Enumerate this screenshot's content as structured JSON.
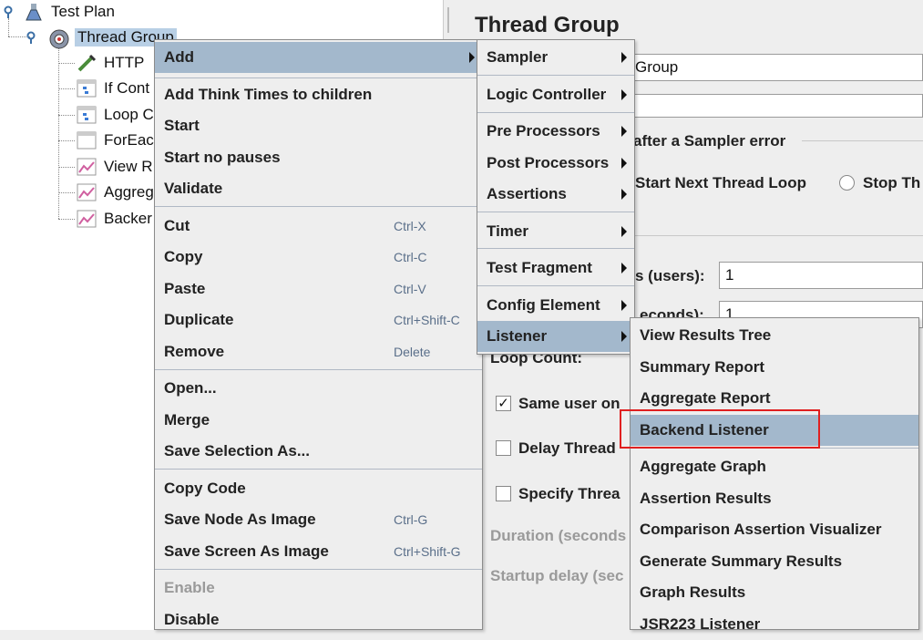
{
  "tree": {
    "items": [
      {
        "label": "Test Plan",
        "icon": "flask-icon"
      },
      {
        "label": "Thread Group",
        "icon": "gear-icon"
      },
      {
        "label": "HTTP",
        "icon": "pipette-icon"
      },
      {
        "label": "If Cont",
        "icon": "controller-icon"
      },
      {
        "label": "Loop C",
        "icon": "controller-icon"
      },
      {
        "label": "ForEac",
        "icon": "controller-icon"
      },
      {
        "label": "View R",
        "icon": "graph-icon"
      },
      {
        "label": "Aggreg",
        "icon": "graph-icon"
      },
      {
        "label": "Backer",
        "icon": "graph-icon"
      }
    ]
  },
  "panel": {
    "title": "Thread Group",
    "name_value": "Group",
    "sampler_error_label": "after a Sampler error",
    "radio_start_next": "Start Next Thread Loop",
    "radio_stop": "Stop Th",
    "threads_label": "s (users):",
    "threads_value": "1",
    "rampup_label": "econds):",
    "rampup_value": "1",
    "loop_label": "Loop Count:",
    "same_user_label": "Same user on",
    "delay_label": "Delay Thread",
    "specify_label": "Specify Threa",
    "duration_label": "Duration (seconds",
    "startup_label": "Startup delay (sec"
  },
  "context_menu": {
    "add": "Add",
    "add_think_times": "Add Think Times to children",
    "start": "Start",
    "start_no_pauses": "Start no pauses",
    "validate": "Validate",
    "cut": "Cut",
    "cut_sc": "Ctrl-X",
    "copy": "Copy",
    "copy_sc": "Ctrl-C",
    "paste": "Paste",
    "paste_sc": "Ctrl-V",
    "duplicate": "Duplicate",
    "duplicate_sc": "Ctrl+Shift-C",
    "remove": "Remove",
    "remove_sc": "Delete",
    "open": "Open...",
    "merge": "Merge",
    "save_selection": "Save Selection As...",
    "copy_code": "Copy Code",
    "save_node_image": "Save Node As Image",
    "save_node_image_sc": "Ctrl-G",
    "save_screen_image": "Save Screen As Image",
    "save_screen_image_sc": "Ctrl+Shift-G",
    "enable": "Enable",
    "disable": "Disable"
  },
  "add_menu": {
    "sampler": "Sampler",
    "logic_controller": "Logic Controller",
    "pre_processors": "Pre Processors",
    "post_processors": "Post Processors",
    "assertions": "Assertions",
    "timer": "Timer",
    "test_fragment": "Test Fragment",
    "config_element": "Config Element",
    "listener": "Listener"
  },
  "listener_menu": {
    "view_results_tree": "View Results Tree",
    "summary_report": "Summary Report",
    "aggregate_report": "Aggregate Report",
    "backend_listener": "Backend Listener",
    "aggregate_graph": "Aggregate Graph",
    "assertion_results": "Assertion Results",
    "comparison_assertion_visualizer": "Comparison Assertion Visualizer",
    "generate_summary_results": "Generate Summary Results",
    "graph_results": "Graph Results",
    "jsr223_listener": "JSR223 Listener"
  },
  "colors": {
    "highlight": "#a3b8cc",
    "tree_selection": "#b8cfe5",
    "annotation_box": "#e02020"
  }
}
